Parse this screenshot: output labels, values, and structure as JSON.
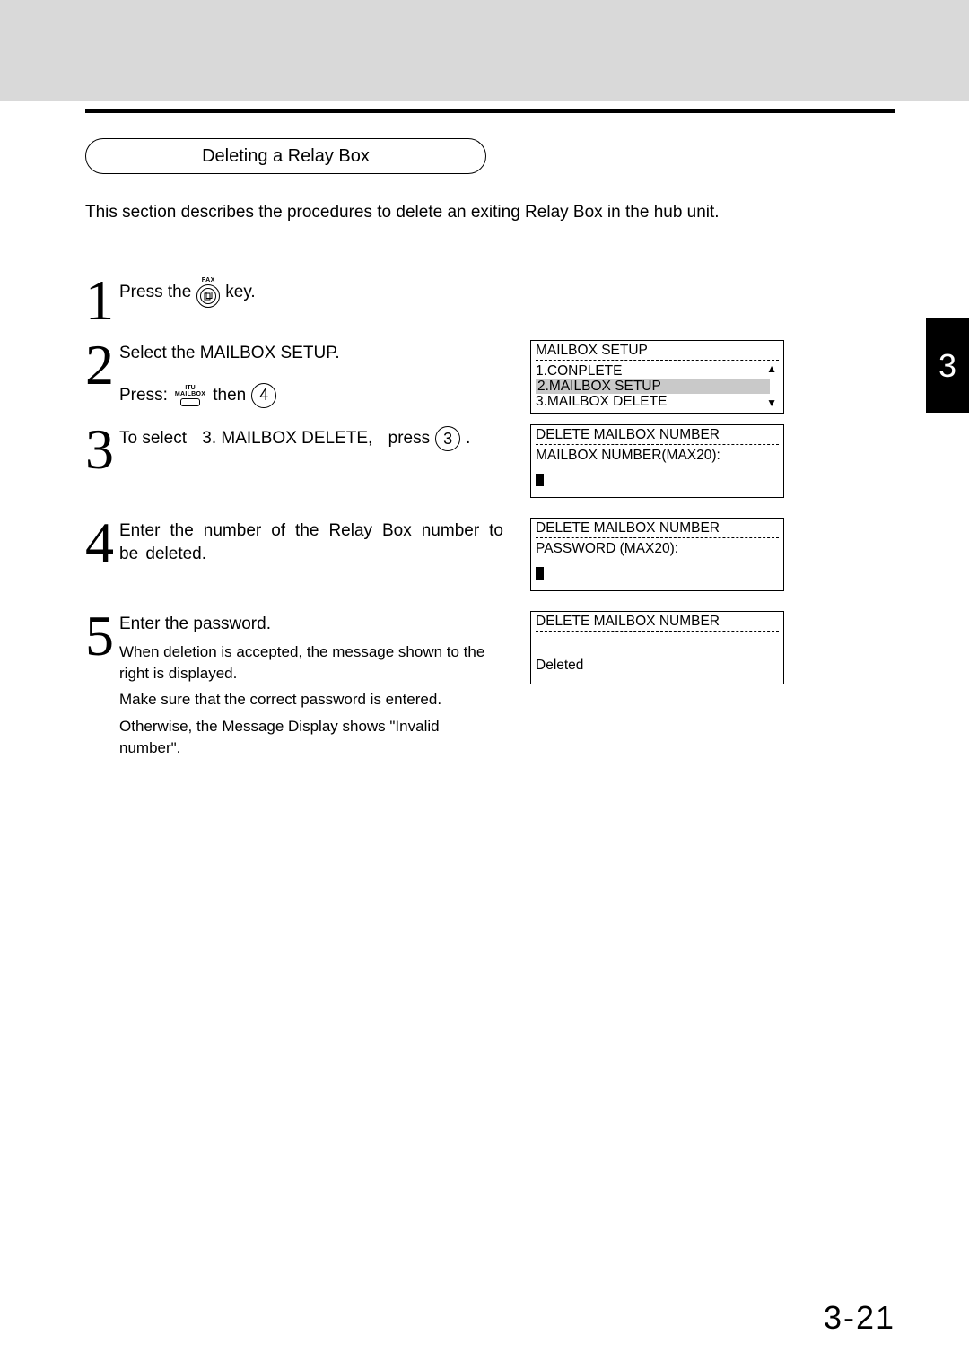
{
  "section_title": "Deleting a Relay Box",
  "intro": "This section describes the procedures to delete an exiting Relay Box in the hub unit.",
  "side_tab": "3",
  "page_number": "3-21",
  "fax_key": {
    "top": "FAX",
    "glyph": "⿻"
  },
  "mailbox_key": {
    "top": "ITU",
    "mid": "MAILBOX"
  },
  "steps": {
    "s1": {
      "num": "1",
      "pre": "Press the",
      "post": "key."
    },
    "s2": {
      "num": "2",
      "line1": "Select the MAILBOX SETUP.",
      "press": "Press:",
      "then": "then",
      "btn": "4",
      "lcd": {
        "title": "MAILBOX SETUP",
        "opt1": "1.CONPLETE",
        "opt2": "2.MAILBOX SETUP",
        "opt3": "3.MAILBOX DELETE"
      }
    },
    "s3": {
      "num": "3",
      "pre": "To select",
      "item": "3. MAILBOX DELETE,",
      "press": "press",
      "btn": "3",
      "dot": ".",
      "lcd": {
        "title": "DELETE MAILBOX NUMBER",
        "line2": "MAILBOX NUMBER(MAX20):"
      }
    },
    "s4": {
      "num": "4",
      "text": "Enter the number of the Relay Box number to be deleted.",
      "lcd": {
        "title": "DELETE MAILBOX NUMBER",
        "line2": "PASSWORD (MAX20):"
      }
    },
    "s5": {
      "num": "5",
      "line1": "Enter the password.",
      "sub1": "When deletion is accepted, the message shown to the right is displayed.",
      "sub2": "Make sure that the correct password is entered.",
      "sub3": "Otherwise, the Message Display shows \"Invalid number\".",
      "lcd": {
        "title": "DELETE MAILBOX NUMBER",
        "result": "Deleted"
      }
    }
  }
}
